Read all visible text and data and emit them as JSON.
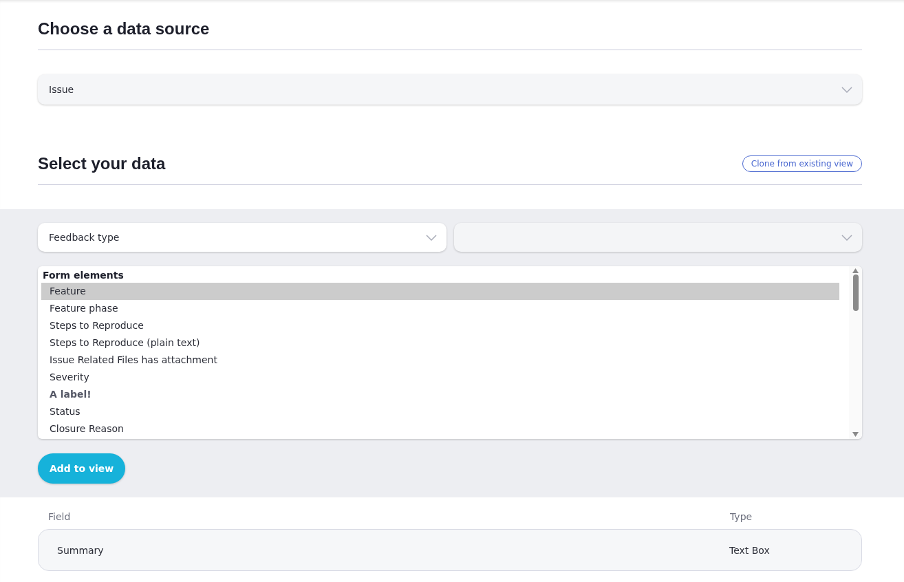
{
  "source_section": {
    "title": "Choose a data source",
    "select": {
      "value": "Issue"
    }
  },
  "data_section": {
    "title": "Select your data",
    "clone_button": "Clone from existing view"
  },
  "filters": [
    {
      "kind": "chosen",
      "value": "Feedback type"
    },
    {
      "kind": "blank"
    }
  ],
  "field_list": [
    {
      "kind": "group",
      "label": "Form elements"
    },
    {
      "kind": "option",
      "label": "Feature",
      "selected": true
    },
    {
      "kind": "option",
      "label": "Feature phase",
      "selected": false
    },
    {
      "kind": "option",
      "label": "Steps to Reproduce",
      "selected": false
    },
    {
      "kind": "option",
      "label": "Steps to Reproduce (plain text)",
      "selected": false
    },
    {
      "kind": "option",
      "label": "Issue Related Files has attachment",
      "selected": false
    },
    {
      "kind": "option",
      "label": "Severity",
      "selected": false
    },
    {
      "kind": "label",
      "label": "A label!"
    },
    {
      "kind": "option",
      "label": "Status",
      "selected": false
    },
    {
      "kind": "option",
      "label": "Closure Reason",
      "selected": false
    }
  ],
  "add_button": "Add to view",
  "table": {
    "columns": [
      "Field",
      "Type"
    ],
    "rows": [
      {
        "field": "Summary",
        "type": "Text Box"
      }
    ]
  }
}
